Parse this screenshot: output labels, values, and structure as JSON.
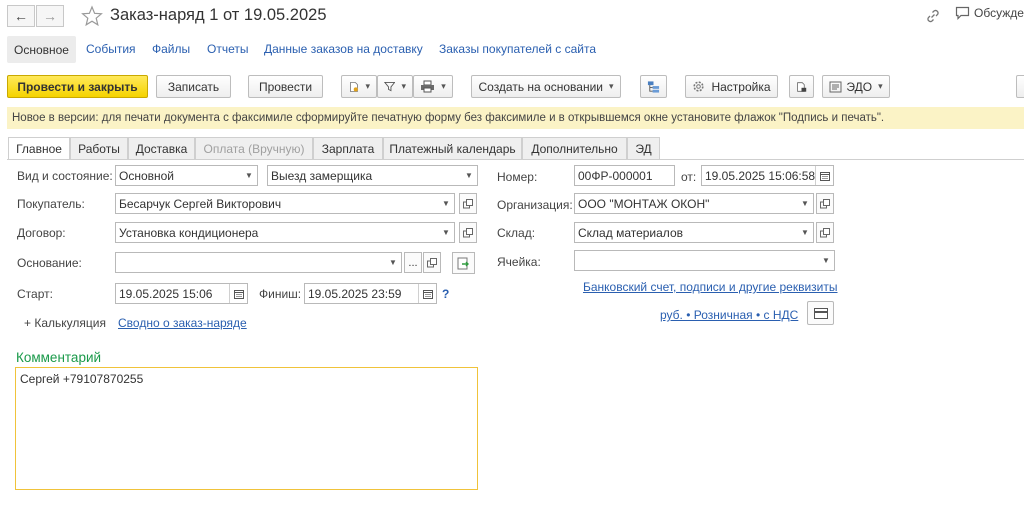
{
  "window": {
    "title": "Заказ-наряд 1 от 19.05.2025",
    "discuss_label": "Обсуждение"
  },
  "sections": {
    "active": "Основное",
    "links": [
      "События",
      "Файлы",
      "Отчеты",
      "Данные заказов на доставку",
      "Заказы покупателей с сайта"
    ]
  },
  "toolbar": {
    "post_close": "Провести и закрыть",
    "save": "Записать",
    "post": "Провести",
    "create_based": "Создать на основании",
    "settings": "Настройка",
    "edo": "ЭДО"
  },
  "banner": {
    "text": "Новое в версии: для печати документа с факсимиле сформируйте печатную форму без факсимиле и в открывшемся окне установите флажок \"Подпись и печать\"."
  },
  "tabs": [
    {
      "label": "Главное",
      "state": "active"
    },
    {
      "label": "Работы",
      "state": "normal"
    },
    {
      "label": "Доставка",
      "state": "normal"
    },
    {
      "label": "Оплата (Вручную)",
      "state": "disabled"
    },
    {
      "label": "Зарплата",
      "state": "normal"
    },
    {
      "label": "Платежный календарь",
      "state": "normal"
    },
    {
      "label": "Дополнительно",
      "state": "normal"
    },
    {
      "label": "ЭД",
      "state": "normal"
    }
  ],
  "form": {
    "kind_label": "Вид и состояние:",
    "kind_value": "Основной",
    "state_value": "Выезд замерщика",
    "buyer_label": "Покупатель:",
    "buyer_value": "Бесарчук Сергей Викторович",
    "contract_label": "Договор:",
    "contract_value": "Установка кондиционера",
    "basis_label": "Основание:",
    "basis_value": "",
    "basis_more": "...",
    "start_label": "Старт:",
    "start_value": "19.05.2025 15:06",
    "finish_label": "Финиш:",
    "finish_value": "19.05.2025 23:59",
    "help": "?",
    "calc_label": "+ Калькуляция",
    "summary_link": "Сводно о заказ-наряде",
    "number_label": "Номер:",
    "number_value": "00ФР-000001",
    "date_from_label": "от:",
    "date_value": "19.05.2025 15:06:58",
    "org_label": "Организация:",
    "org_value": "ООО \"МОНТАЖ ОКОН\"",
    "warehouse_label": "Склад:",
    "warehouse_value": "Склад материалов",
    "cell_label": "Ячейка:",
    "cell_value": "",
    "bank_link": "Банковский счет, подписи и другие реквизиты",
    "price_link": "руб. • Розничная • с НДС"
  },
  "comment": {
    "label": "Комментарий",
    "text": "Сергей +79107870255"
  },
  "colors": {
    "primary_button": "#f5d300",
    "link": "#2a5fb0",
    "banner": "#fbf3c6",
    "comment_label": "#1a9a4a",
    "comment_border": "#f0c33a"
  }
}
